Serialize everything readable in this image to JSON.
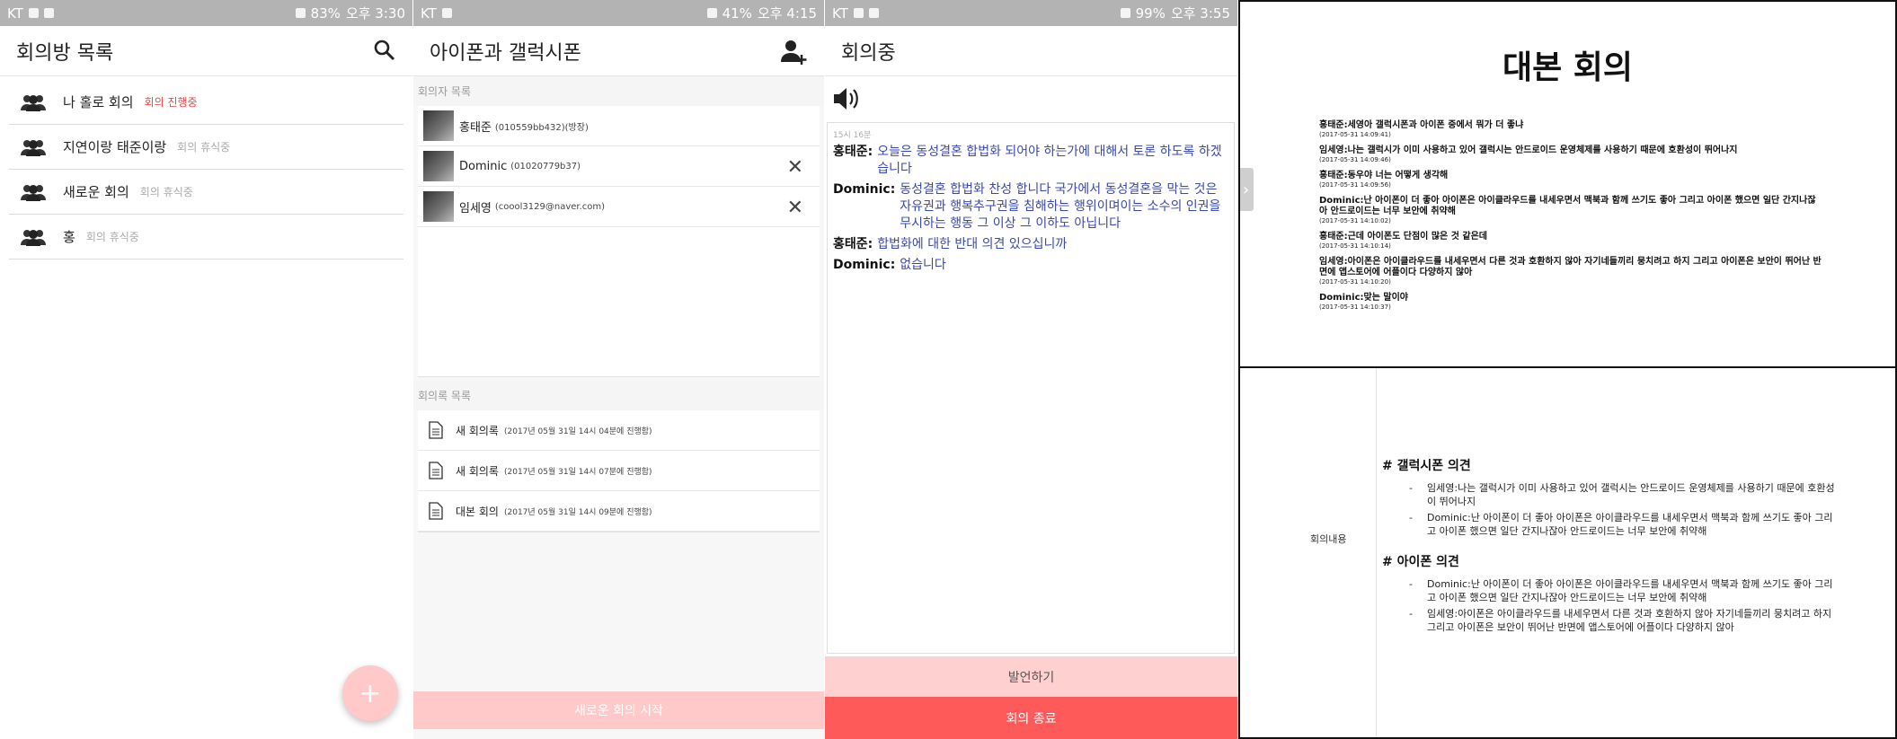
{
  "screen1": {
    "status": {
      "carrier": "KT",
      "battery": "83%",
      "time": "오후 3:30"
    },
    "title": "회의방 목록",
    "rooms": [
      {
        "name": "나 홀로 회의",
        "status": "회의 진행중",
        "live": true
      },
      {
        "name": "지연이랑 태준이랑",
        "status": "회의 휴식중",
        "live": false
      },
      {
        "name": "새로운 회의",
        "status": "회의 휴식중",
        "live": false
      },
      {
        "name": "홍",
        "status": "회의 휴식중",
        "live": false
      }
    ],
    "fab": "+"
  },
  "screen2": {
    "status": {
      "carrier": "KT",
      "battery": "41%",
      "time": "오후 4:15"
    },
    "title": "아이폰과 갤럭시폰",
    "members_label": "회의자 목록",
    "members": [
      {
        "name": "홍태준",
        "sub": "(010559bb432)(방장)"
      },
      {
        "name": "Dominic",
        "sub": "(01020779b37)"
      },
      {
        "name": "임세영",
        "sub": "(coool3129@naver.com)"
      }
    ],
    "minutes_label": "회의록 목록",
    "minutes": [
      {
        "title": "새 회의록",
        "date": "(2017년 05월 31일 14시 04분에 진행함)"
      },
      {
        "title": "새 회의록",
        "date": "(2017년 05월 31일 14시 07분에 진행함)"
      },
      {
        "title": "대본 회의",
        "date": "(2017년 05월 31일 14시 09분에 진행함)"
      }
    ],
    "start_button": "새로운 회의 시작"
  },
  "screen3": {
    "status": {
      "carrier": "KT",
      "battery": "99%",
      "time": "오후 3:55"
    },
    "title": "회의중",
    "chat_time": "15시 16분",
    "messages": [
      {
        "who": "홍태준:",
        "text": "오늘은 동성결혼 합법화 되어야 하는가에 대해서 토론 하도록 하겠습니다"
      },
      {
        "who": "Dominic:",
        "text": "동성결혼 합법화 찬성 합니다 국가에서 동성결혼을 막는 것은 자유권과 행복추구권을 침해하는 행위이며이는 소수의 인권을 무시하는 행동 그 이상 그 이하도 아닙니다"
      },
      {
        "who": "홍태준:",
        "text": "합법화에 대한 반대 의견 있으십니까"
      },
      {
        "who": "Dominic:",
        "text": "없습니다"
      }
    ],
    "speak_button": "발언하기",
    "end_button": "회의 종료"
  },
  "doc": {
    "title": "대본 회의",
    "handle": "›",
    "entries": [
      {
        "text": "홍태준:세영아 갤럭시폰과 아이폰 중에서 뭐가 더 좋냐",
        "time": "(2017-05-31 14:09:41)"
      },
      {
        "text": "임세영:나는 갤럭시가 이미 사용하고 있어 갤럭시는 안드로이드 운영체제를 사용하기 때문에 호환성이 뛰어나지",
        "time": "(2017-05-31 14:09:46)"
      },
      {
        "text": "홍태준:동우야 너는 어떻게 생각해",
        "time": "(2017-05-31 14:09:56)"
      },
      {
        "text": "Dominic:난 아이폰이 더 좋아 아이폰은 아이클라우드를 내세우면서 맥북과 함께 쓰기도 좋아 그리고 아이폰 했으면 일단 간지나잖아 안드로이드는 너무 보안에 취약해",
        "time": "(2017-05-31 14:10:02)"
      },
      {
        "text": "홍태준:근데 아이폰도 단점이 많은 것 같은데",
        "time": "(2017-05-31 14:10:14)"
      },
      {
        "text": "임세영:아이폰은 아이클라우드를 내세우면서 다른 것과 호환하지 않아 자기네들끼리 뭉치려고 하지 그리고 아이폰은 보안이 뛰어난 반면에 앱스토어에 어플이다 다양하지 않아",
        "time": "(2017-05-31 14:10:20)"
      },
      {
        "text": "Dominic:맞는 말이야",
        "time": "(2017-05-31 14:10:37)"
      }
    ]
  },
  "summary": {
    "label": "회의내용",
    "sections": [
      {
        "heading": "# 갤럭시폰 의견",
        "bullets": [
          "임세영:나는 갤럭시가 이미 사용하고 있어 갤럭시는 안드로이드 운영체제를 사용하기 때문에 호환성이 뛰어나지",
          "Dominic:난 아이폰이 더 좋아 아이폰은 아이클라우드를 내세우면서 맥북과 함께 쓰기도 좋아 그리고 아이폰 했으면 일단 간지나잖아 안드로이드는 너무 보안에 취약해"
        ]
      },
      {
        "heading": "# 아이폰 의견",
        "bullets": [
          "Dominic:난 아이폰이 더 좋아 아이폰은 아이클라우드를 내세우면서 맥북과 함께 쓰기도 좋아 그리고 아이폰 했으면 일단 간지나잖아 안드로이드는 너무 보안에 취약해",
          "임세영:아이폰은 아이클라우드를 내세우면서 다른 것과 호환하지 않아 자기네들끼리 뭉치려고 하지 그리고 아이폰은 보안이 뛰어난 반면에 앱스토어에 어플이다 다양하지 않아"
        ]
      }
    ]
  },
  "colors": {
    "accent_red": "#ff5a5a",
    "light_pink": "#ffc9c9",
    "chat_blue": "#3949ab"
  }
}
